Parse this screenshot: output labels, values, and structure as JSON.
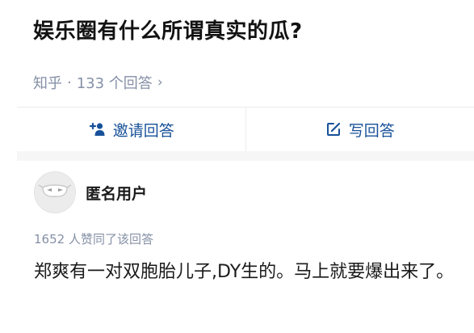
{
  "question": {
    "title": "娱乐圈有什么所谓真实的瓜?"
  },
  "meta": {
    "source": "知乎",
    "separator": "·",
    "answer_count": "133 个回答",
    "chevron": "›"
  },
  "actions": {
    "invite_label": "邀请回答",
    "invite_icon": "add-person-icon",
    "write_label": "写回答",
    "write_icon": "edit-icon",
    "accent": "#175199"
  },
  "answer": {
    "author": "匿名用户",
    "votes": "1652 人赞同了该回答",
    "text": "郑爽有一对双胞胎儿子,DY生的。马上就要爆出来了。"
  }
}
